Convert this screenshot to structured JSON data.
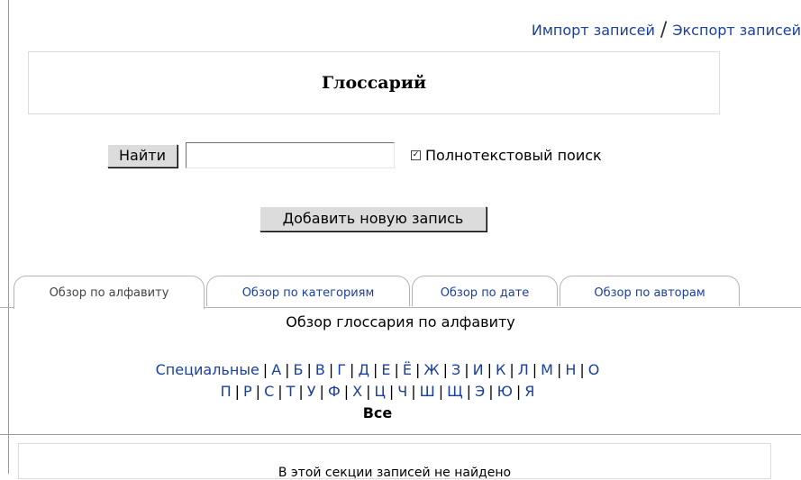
{
  "header": {
    "import_label": "Импорт записей",
    "separator": "/",
    "export_label": "Экспорт записей"
  },
  "title": "Глоссарий",
  "search": {
    "button_label": "Найти",
    "input_value": "",
    "fulltext_label": "Полнотекстовый поиск",
    "fulltext_checked": true
  },
  "add_entry_label": "Добавить новую запись",
  "tabs": [
    {
      "label": "Обзор по алфавиту",
      "active": true
    },
    {
      "label": "Обзор по категориям",
      "active": false
    },
    {
      "label": "Обзор по дате",
      "active": false
    },
    {
      "label": "Обзор по авторам",
      "active": false
    }
  ],
  "browse_title": "Обзор глоссария по алфавиту",
  "alphabet": {
    "special": "Специальные",
    "row1": [
      "А",
      "Б",
      "В",
      "Г",
      "Д",
      "Е",
      "Ё",
      "Ж",
      "З",
      "И",
      "К",
      "Л",
      "М",
      "Н",
      "О"
    ],
    "row2": [
      "П",
      "Р",
      "С",
      "Т",
      "У",
      "Ф",
      "Х",
      "Ц",
      "Ч",
      "Ш",
      "Щ",
      "Э",
      "Ю",
      "Я"
    ],
    "all": "Все"
  },
  "empty_message": "В этой секции записей не найдено",
  "colors": {
    "link": "#1a3f9e",
    "button_bg": "#dcdcdc"
  }
}
